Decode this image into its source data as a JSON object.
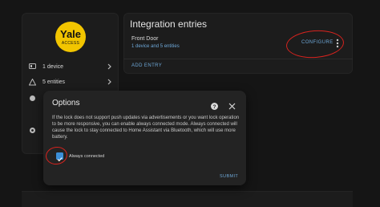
{
  "device_card": {
    "logo_word": "Yale",
    "logo_sub": "ACCESS",
    "rows": [
      {
        "label": "1 device",
        "icon": "device-icon"
      },
      {
        "label": "5 entities",
        "icon": "entities-icon"
      },
      {
        "label": "",
        "icon": "settings-icon"
      },
      {
        "label": "",
        "icon": "bug-icon"
      }
    ]
  },
  "integration": {
    "title": "Integration entries",
    "entry_name": "Front Door",
    "entry_detail": "1 device and 5 entities",
    "configure_label": "CONFIGURE",
    "add_entry_label": "ADD ENTRY"
  },
  "dialog": {
    "title": "Options",
    "body": "If the lock does not support push updates via advertisements or you want lock operation to be more responsive, you can enable always connected mode. Always connected will cause the lock to stay connected to Home Assistant via Bluetooth, which will use more battery.",
    "checkbox_label": "Always connected",
    "checkbox_checked": true,
    "submit_label": "SUBMIT"
  },
  "colors": {
    "background": "#151515",
    "card": "#1c1c1c",
    "accent": "#6ea8d8",
    "checkbox": "#3b8fd8",
    "annotation": "#d8231e",
    "logo": "#f2c500"
  }
}
